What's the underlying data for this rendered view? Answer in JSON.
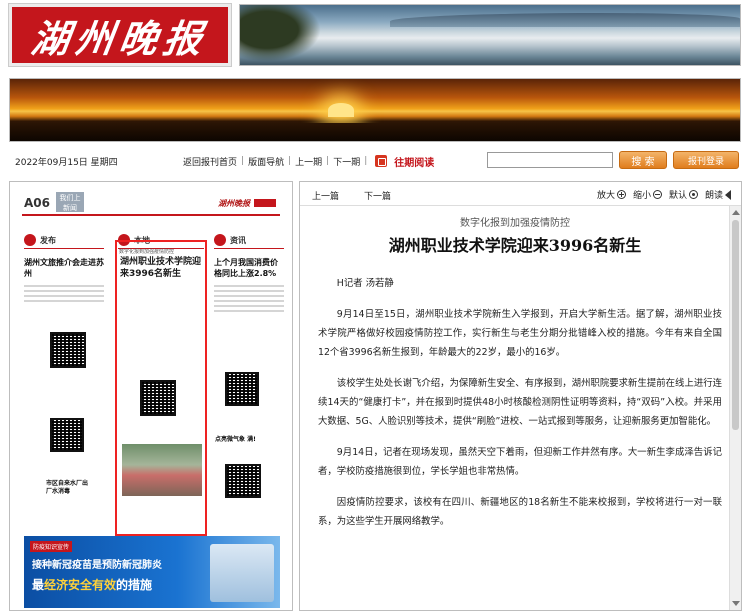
{
  "site": {
    "logo_text": "湖州晚报"
  },
  "nav": {
    "date": "2022年09月15日 星期四",
    "links": [
      "返回报刊首页",
      "版面导航",
      "上一期",
      "下一期"
    ],
    "archive_label": "往期阅读",
    "search_placeholder": "",
    "search_button": "搜 索",
    "login_button": "报刊登录"
  },
  "newspaper_page": {
    "page_no": "A06",
    "badge": "我们上 新闻",
    "logo_small": "湖州晚报",
    "columns": [
      {
        "head": "发布",
        "title": "湖州文旅推介会走进苏州"
      },
      {
        "head": "本地",
        "title": "湖州职业技术学院迎来3996名新生"
      },
      {
        "head": "资讯",
        "title": "上个月我国消费价格同比上涨2.8%"
      }
    ],
    "highlight_kicker": "数字化报到加强疫情防控",
    "highlight_title": "湖州职业技术学院迎来3996名新生",
    "side_title_1": "点亮微气象 满!",
    "side_title_2": "市区自来水厂出厂水消毒",
    "ad": {
      "tag": "防疫知识宣传",
      "line1": "接种新冠疫苗是预防新冠肺炎",
      "line2_a": "最",
      "line2_hl": "经济安全有效",
      "line2_b": "的措施"
    }
  },
  "article": {
    "toolbar": {
      "prev": "上一篇",
      "next": "下一篇",
      "zoom_in": "放大",
      "zoom_out": "缩小",
      "default": "默认",
      "read": "朗读"
    },
    "kicker": "数字化报到加强疫情防控",
    "title": "湖州职业技术学院迎来3996名新生",
    "byline": "H记者 汤若静",
    "paragraphs": [
      "9月14日至15日，湖州职业技术学院新生入学报到，开启大学新生活。据了解，湖州职业技术学院严格做好校园疫情防控工作，实行新生与老生分期分批错峰入校的措施。今年有来自全国12个省3996名新生报到，年龄最大的22岁，最小的16岁。",
      "该校学生处处长谢飞介绍，为保障新生安全、有序报到，湖州职院要求新生提前在线上进行连续14天的“健康打卡”，并在报到时提供48小时核酸检测阴性证明等资料，持“双码”入校。并采用大数据、5G、人脸识别等技术，提供“刷脸”进校、一站式报到等服务，让迎新服务更加智能化。",
      "9月14日，记者在现场发现，虽然天空下着雨，但迎新工作井然有序。大一新生李成泽告诉记者，学校防疫措施很到位，学长学姐也非常热情。",
      "因疫情防控要求，该校有在四川、新疆地区的18名新生不能来校报到，学校将进行一对一联系，为这些学生开展网络教学。"
    ]
  }
}
